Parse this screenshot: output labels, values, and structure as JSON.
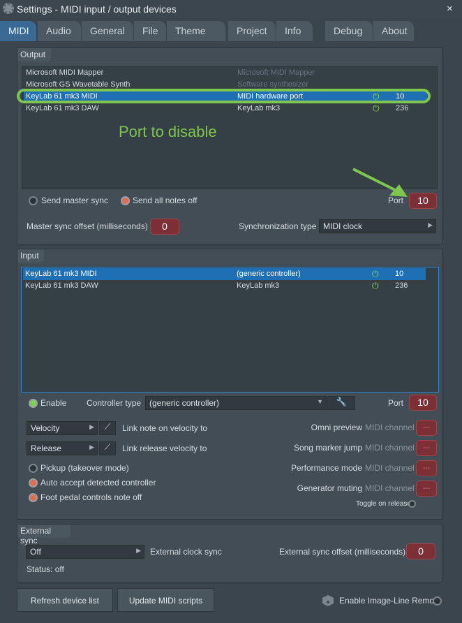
{
  "window": {
    "title": "Settings - MIDI input / output devices",
    "close": "×"
  },
  "tabs": [
    "MIDI",
    "Audio",
    "General",
    "File",
    "Theme",
    "Project",
    "Info",
    "Debug",
    "About"
  ],
  "output": {
    "header": "Output",
    "rows": [
      {
        "name": "Microsoft MIDI Mapper",
        "controller": "Microsoft MIDI Mapper",
        "port": "",
        "enabled": false
      },
      {
        "name": "Microsoft GS Wavetable Synth",
        "controller": "Software synthesizer",
        "port": "",
        "enabled": false
      },
      {
        "name": "KeyLab 61 mk3 MIDI",
        "controller": "MIDI hardware port",
        "port": "10",
        "enabled": true
      },
      {
        "name": "KeyLab 61 mk3 DAW",
        "controller": "KeyLab mk3",
        "port": "236",
        "enabled": true
      }
    ],
    "send_master_sync": "Send master sync",
    "send_all_notes_off": "Send all notes off",
    "port_label": "Port",
    "port_value": "10",
    "master_sync_offset_label": "Master sync offset (milliseconds)",
    "master_sync_offset_value": "0",
    "sync_type_label": "Synchronization type",
    "sync_type_value": "MIDI clock"
  },
  "annotation": {
    "text": "Port to disable",
    "color": "#7ec64e"
  },
  "input": {
    "header": "Input",
    "rows": [
      {
        "name": "KeyLab 61 mk3 MIDI",
        "controller": "(generic controller)",
        "port": "10"
      },
      {
        "name": "KeyLab 61 mk3 DAW",
        "controller": "KeyLab mk3",
        "port": "236"
      }
    ],
    "enable_label": "Enable",
    "controller_type_label": "Controller type",
    "controller_type_value": "(generic controller)",
    "port_label": "Port",
    "port_value": "10",
    "velocity_value": "Velocity",
    "link_velocity_label": "Link note on velocity to",
    "release_value": "Release",
    "link_release_label": "Link release velocity to",
    "pickup_label": "Pickup (takeover mode)",
    "auto_accept_label": "Auto accept detected controller",
    "foot_pedal_label": "Foot pedal controls note off",
    "omni_label": "Omni preview",
    "song_marker_label": "Song marker jump",
    "performance_label": "Performance mode",
    "generator_label": "Generator muting",
    "midi_channel": "MIDI channel",
    "empty_value": "---",
    "toggle_release_label": "Toggle on release"
  },
  "external": {
    "header": "External sync",
    "clock_value": "Off",
    "clock_label": "External clock sync",
    "offset_label": "External sync offset (milliseconds)",
    "offset_value": "0",
    "status": "Status: off"
  },
  "bottom": {
    "refresh": "Refresh device list",
    "update": "Update MIDI scripts",
    "remote": "Enable Image-Line Remote"
  },
  "icons": {
    "power": "⏻",
    "wrench": "🔧",
    "arrow": "▶",
    "link": "⟋"
  },
  "colors": {
    "accent": "#1f6fb5",
    "highlight": "#7ec64e",
    "value_box": "#7d2f36"
  }
}
